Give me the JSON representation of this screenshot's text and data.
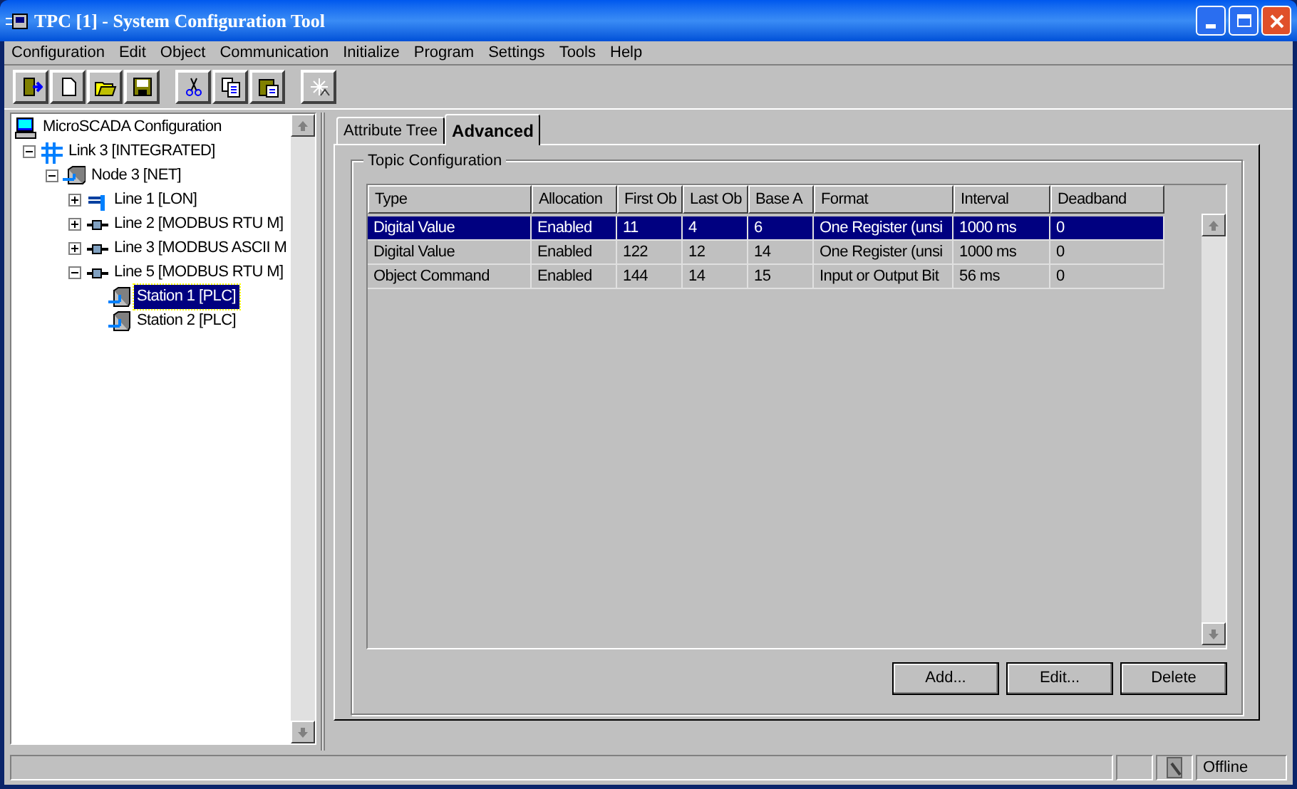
{
  "window": {
    "title": "TPC [1] - System Configuration Tool"
  },
  "menu": [
    "Configuration",
    "Edit",
    "Object",
    "Communication",
    "Initialize",
    "Program",
    "Settings",
    "Tools",
    "Help"
  ],
  "toolbar": [
    {
      "kind": "exit"
    },
    {
      "kind": "new"
    },
    {
      "kind": "open"
    },
    {
      "kind": "save"
    },
    {
      "kind": "gap"
    },
    {
      "kind": "cut"
    },
    {
      "kind": "copy"
    },
    {
      "kind": "paste"
    },
    {
      "kind": "gap"
    },
    {
      "kind": "wizard"
    }
  ],
  "tree": [
    {
      "label": "MicroSCADA Configuration",
      "kind": "computer",
      "selected": false,
      "children": [
        {
          "label": "Link 3 [INTEGRATED]",
          "kind": "link",
          "selected": false,
          "expanded": true,
          "children": [
            {
              "label": "Node 3 [NET]",
              "kind": "node",
              "selected": false,
              "expanded": true,
              "children": [
                {
                  "label": "Line 1 [LON]",
                  "kind": "lon",
                  "selected": false,
                  "expanded": false
                },
                {
                  "label": "Line 2 [MODBUS RTU M]",
                  "kind": "serial",
                  "selected": false,
                  "expanded": false
                },
                {
                  "label": "Line 3 [MODBUS ASCII M",
                  "kind": "serial",
                  "selected": false,
                  "expanded": false
                },
                {
                  "label": "Line 5 [MODBUS RTU M]",
                  "kind": "serial",
                  "selected": false,
                  "expanded": true,
                  "children": [
                    {
                      "label": "Station 1 [PLC]",
                      "kind": "station",
                      "selected": true
                    },
                    {
                      "label": "Station 2 [PLC]",
                      "kind": "station",
                      "selected": false
                    }
                  ]
                }
              ]
            }
          ]
        }
      ]
    }
  ],
  "tabs": [
    {
      "label": "Attribute Tree",
      "selected": false
    },
    {
      "label": "Advanced",
      "selected": true
    }
  ],
  "group": {
    "title": "Topic Configuration"
  },
  "table": {
    "columns": [
      "Type",
      "Allocation",
      "First Ob",
      "Last Ob",
      "Base A",
      "Format",
      "Interval",
      "Deadband"
    ],
    "rows": [
      {
        "selected": true,
        "cells": [
          "Digital Value",
          "Enabled",
          "11",
          "4",
          "6",
          "One Register (unsi",
          "1000 ms",
          "0"
        ]
      },
      {
        "selected": false,
        "cells": [
          "Digital Value",
          "Enabled",
          "122",
          "12",
          "14",
          "One Register (unsi",
          "1000 ms",
          "0"
        ]
      },
      {
        "selected": false,
        "cells": [
          "Object Command",
          "Enabled",
          "144",
          "14",
          "15",
          "Input or Output Bit",
          "56 ms",
          "0"
        ]
      }
    ]
  },
  "buttons": [
    "Add...",
    "Edit...",
    "Delete"
  ],
  "status_bar": {
    "state": "Offline"
  }
}
